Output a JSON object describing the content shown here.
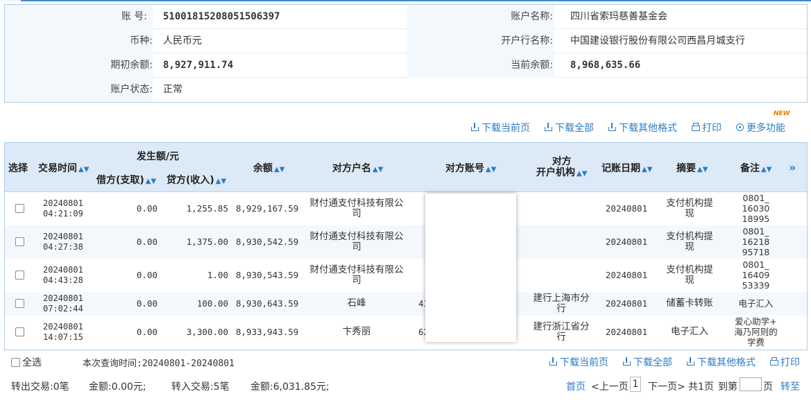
{
  "account": {
    "account_no_label": "账 号:",
    "account_no": "51001815208051506397",
    "account_name_label": "账户名称:",
    "account_name": "四川省索玛慈善基金会",
    "currency_label": "币种:",
    "currency": "人民币元",
    "bank_label": "开户行名称:",
    "bank": "中国建设银行股份有限公司西昌月城支行",
    "opening_balance_label": "期初余额:",
    "opening_balance": "8,927,911.74",
    "current_balance_label": "当前余额:",
    "current_balance": "8,968,635.66",
    "status_label": "账户状态:",
    "status": "正常"
  },
  "toolbar": {
    "download_page": "下载当前页",
    "download_all": "下载全部",
    "download_other": "下载其他格式",
    "print": "打印",
    "more": "更多功能",
    "new_badge": "NEW"
  },
  "table": {
    "headers": {
      "select": "选择",
      "time": "交易时间",
      "amount_group": "发生额/元",
      "debit": "借方(支取)",
      "credit": "贷方(收入)",
      "balance": "余额",
      "cp_name": "对方户名",
      "cp_account": "对方账号",
      "cp_bank_1": "对方",
      "cp_bank_2": "开户机构",
      "post_date": "记账日期",
      "summary": "摘要",
      "remark": "备注",
      "expand": "»"
    },
    "rows": [
      {
        "date": "20240801",
        "time": "04:21:09",
        "debit": "0.00",
        "credit": "1,255.85",
        "balance": "8,929,167.59",
        "cp_name_1": "财付通支付科技有限公",
        "cp_name_2": "司",
        "cp_acct": "",
        "cp_bank_1": "",
        "cp_bank_2": "",
        "post_date": "20240801",
        "summary_1": "支付机构提",
        "summary_2": "现",
        "remark_1": "0801_",
        "remark_2": "16030",
        "remark_3": "18995"
      },
      {
        "date": "20240801",
        "time": "04:27:38",
        "debit": "0.00",
        "credit": "1,375.00",
        "balance": "8,930,542.59",
        "cp_name_1": "财付通支付科技有限公",
        "cp_name_2": "司",
        "cp_acct": "",
        "cp_bank_1": "",
        "cp_bank_2": "",
        "post_date": "20240801",
        "summary_1": "支付机构提",
        "summary_2": "现",
        "remark_1": "0801_",
        "remark_2": "16218",
        "remark_3": "95718"
      },
      {
        "date": "20240801",
        "time": "04:43:28",
        "debit": "0.00",
        "credit": "1.00",
        "balance": "8,930,543.59",
        "cp_name_1": "财付通支付科技有限公",
        "cp_name_2": "司",
        "cp_acct": "",
        "cp_bank_1": "",
        "cp_bank_2": "",
        "post_date": "20240801",
        "summary_1": "支付机构提",
        "summary_2": "现",
        "remark_1": "0801_",
        "remark_2": "16409",
        "remark_3": "53339"
      },
      {
        "date": "20240801",
        "time": "07:02:44",
        "debit": "0.00",
        "credit": "100.00",
        "balance": "8,930,643.59",
        "cp_name_1": "石峰",
        "cp_name_2": "",
        "cp_acct": "43",
        "cp_bank_1": "建行上海市分",
        "cp_bank_2": "行",
        "post_date": "20240801",
        "summary_1": "储蓄卡转账",
        "summary_2": "",
        "remark_1": "电子汇入",
        "remark_2": "",
        "remark_3": ""
      },
      {
        "date": "20240801",
        "time": "14:07:15",
        "debit": "0.00",
        "credit": "3,300.00",
        "balance": "8,933,943.59",
        "cp_name_1": "卞秀丽",
        "cp_name_2": "",
        "cp_acct": "62",
        "cp_bank_1": "建行浙江省分",
        "cp_bank_2": "行",
        "post_date": "20240801",
        "summary_1": "电子汇入",
        "summary_2": "",
        "remark_1": "爱心助学+",
        "remark_2": "海乃阿则的",
        "remark_3": "学费"
      }
    ]
  },
  "footer": {
    "select_all": "全选",
    "query_time": "本次查询时间:20240801-20240801",
    "download_page": "下载当前页",
    "download_all": "下载全部",
    "download_other": "下载其他格式",
    "print": "打印",
    "out_count": "转出交易:0笔",
    "out_amount": "金额:0.00元;",
    "in_count": "转入交易:5笔",
    "in_amount": "金额:6,031.85元;",
    "first": "首页",
    "prev": "<上一页",
    "current_page": "1",
    "next": "下一页>",
    "total": "共1页",
    "goto": "到第",
    "page_unit": "页",
    "go": "转至"
  }
}
